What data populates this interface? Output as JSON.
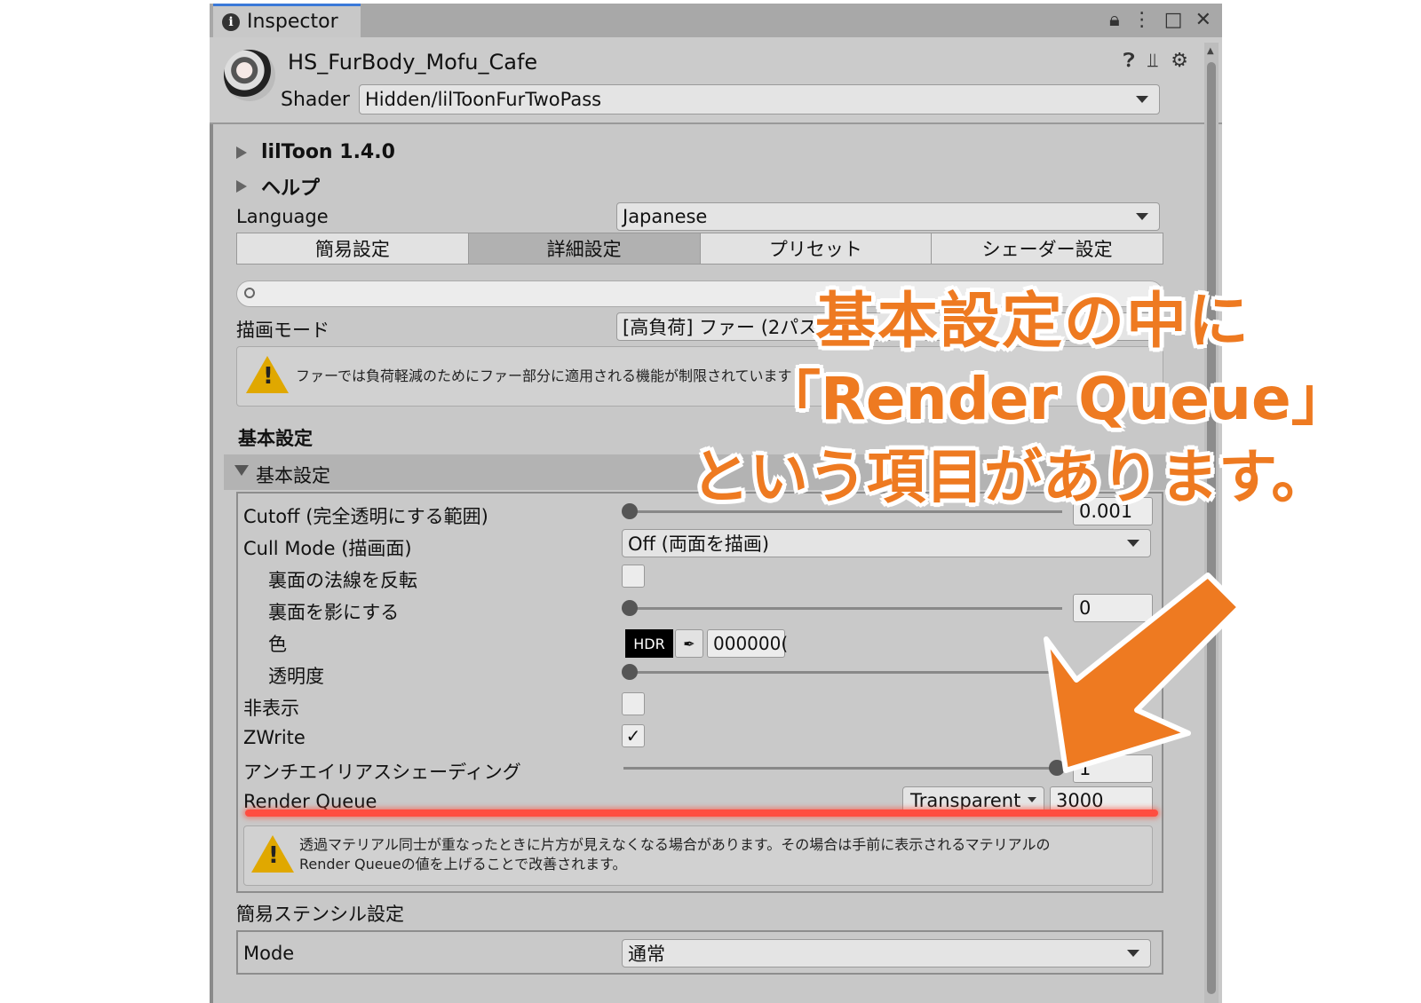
{
  "window": {
    "tab_title": "Inspector",
    "material_name": "HS_FurBody_Mofu_Cafe",
    "shader_label": "Shader",
    "shader_value": "Hidden/lilToonFurTwoPass"
  },
  "foldouts": {
    "version": "lilToon 1.4.0",
    "help": "ヘルプ"
  },
  "language": {
    "label": "Language",
    "value": "Japanese"
  },
  "tabs": [
    "簡易設定",
    "詳細設定",
    "プリセット",
    "シェーダー設定"
  ],
  "active_tab": "詳細設定",
  "render_mode": {
    "label": "描画モード",
    "value": "[高負荷] ファー (2パス)"
  },
  "fur_warning": "ファーでは負荷軽減のためにファー部分に適用される機能が制限されています",
  "base_section": {
    "title": "基本設定",
    "foldout_label": "基本設定",
    "rows": {
      "cutoff": {
        "label": "Cutoff (完全透明にする範囲)",
        "value": "0.001"
      },
      "cull_mode": {
        "label": "Cull Mode (描画面)",
        "value": "Off (両面を描画)"
      },
      "flip_normal": {
        "label": "裏面の法線を反転",
        "checked": false
      },
      "backface_shadow": {
        "label": "裏面を影にする",
        "value": "0"
      },
      "color": {
        "label": "色",
        "hdr": "HDR",
        "hex": "000000("
      },
      "opacity": {
        "label": "透明度"
      },
      "hide": {
        "label": "非表示",
        "checked": false
      },
      "zwrite": {
        "label": "ZWrite",
        "checked": true
      },
      "aa_shading": {
        "label": "アンチエイリアスシェーディング",
        "value": "1"
      },
      "render_queue": {
        "label": "Render Queue",
        "mode": "Transparent",
        "value": "3000"
      }
    },
    "queue_warning": "透過マテリアル同士が重なったときに片方が見えなくなる場合があります。その場合は手前に表示されるマテリアルのRender Queueの値を上げることで改善されます。"
  },
  "stencil": {
    "title": "簡易ステンシル設定",
    "mode_label": "Mode",
    "mode_value": "通常"
  },
  "annotation": {
    "line1": "基本設定の中に",
    "line2": "「Render Queue」",
    "line3": "という項目があります。"
  },
  "colors": {
    "accent_orange": "#ee7a21",
    "highlight_red": "#ff4d40",
    "panel_bg": "#c8c8c8"
  }
}
